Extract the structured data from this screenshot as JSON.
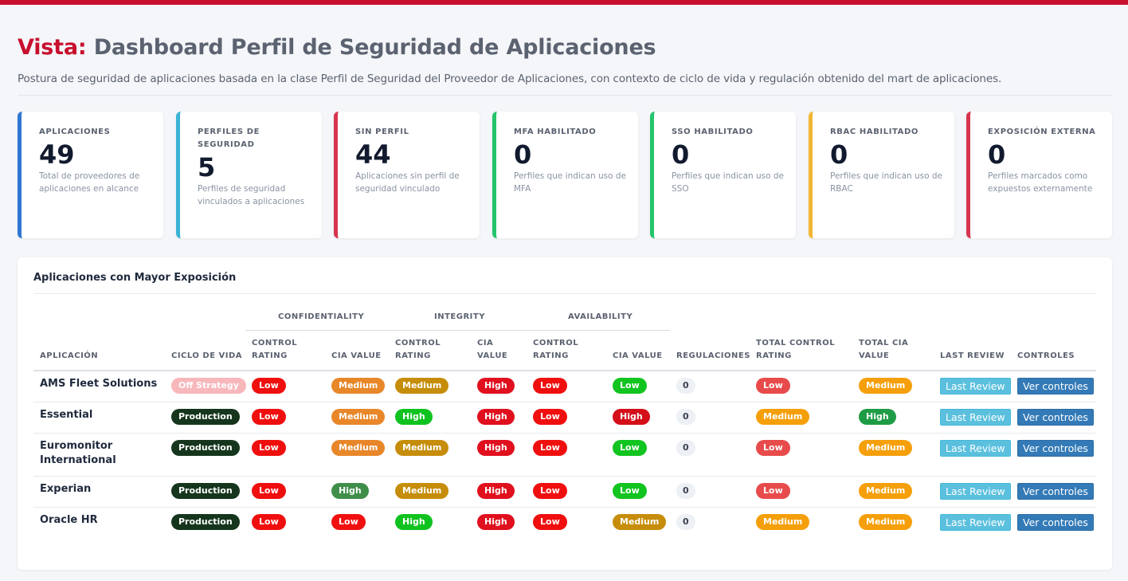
{
  "page": {
    "title_prefix": "Vista:",
    "title": "Dashboard Perfil de Seguridad de Aplicaciones",
    "subtitle": "Postura de seguridad de aplicaciones basada en la clase Perfil de Seguridad del Proveedor de Aplicaciones, con contexto de ciclo de vida y regulación obtenido del mart de aplicaciones."
  },
  "kpis": [
    {
      "label": "APLICACIONES",
      "value": "49",
      "desc": "Total de proveedores de aplicaciones en alcance",
      "color": "#2f76d2"
    },
    {
      "label": "PERFILES DE SEGURIDAD",
      "value": "5",
      "desc": "Perfiles de seguridad vinculados a aplicaciones",
      "color": "#3bb3d6"
    },
    {
      "label": "SIN PERFIL",
      "value": "44",
      "desc": "Aplicaciones sin perfil de seguridad vinculado",
      "color": "#d8344f"
    },
    {
      "label": "MFA HABILITADO",
      "value": "0",
      "desc": "Perfiles que indican uso de MFA",
      "color": "#25c46b"
    },
    {
      "label": "SSO HABILITADO",
      "value": "0",
      "desc": "Perfiles que indican uso de SSO",
      "color": "#25c46b"
    },
    {
      "label": "RBAC HABILITADO",
      "value": "0",
      "desc": "Perfiles que indican uso de RBAC",
      "color": "#f2b632"
    },
    {
      "label": "EXPOSICIÓN EXTERNA",
      "value": "0",
      "desc": "Perfiles marcados como expuestos externamente",
      "color": "#d8344f"
    }
  ],
  "table": {
    "title": "Aplicaciones con Mayor Exposición",
    "groups": {
      "confidentiality": "CONFIDENTIALITY",
      "integrity": "INTEGRITY",
      "availability": "AVAILABILITY"
    },
    "headers": {
      "app": "APLICACIÓN",
      "lifecycle": "CICLO DE VIDA",
      "c_rating": "CONTROL RATING",
      "c_cia": "CIA VALUE",
      "i_rating": "CONTROL RATING",
      "i_cia": "CIA VALUE",
      "a_rating": "CONTROL RATING",
      "a_cia": "CIA VALUE",
      "regs": "REGULACIONES",
      "total_rating": "TOTAL CONTROL RATING",
      "total_cia": "TOTAL CIA VALUE",
      "last_review": "LAST REVIEW",
      "controls": "CONTROLES"
    },
    "rows": [
      {
        "app": "AMS Fleet Solutions",
        "lifecycle": "Off Strategy",
        "c_rating": "Low",
        "c_cia": "Medium",
        "i_rating": "Medium",
        "i_cia": "High",
        "a_rating": "Low",
        "a_cia": "Low",
        "regs": "0",
        "total_rating": "Low",
        "total_cia": "Medium",
        "last_review": "Last Review",
        "controls": "Ver controles"
      },
      {
        "app": "Essential",
        "lifecycle": "Production",
        "c_rating": "Low",
        "c_cia": "Medium",
        "i_rating": "High",
        "i_cia": "High",
        "a_rating": "Low",
        "a_cia": "High",
        "regs": "0",
        "total_rating": "Medium",
        "total_cia": "High",
        "last_review": "Last Review",
        "controls": "Ver controles"
      },
      {
        "app": "Euromonitor International",
        "lifecycle": "Production",
        "c_rating": "Low",
        "c_cia": "Medium",
        "i_rating": "Medium",
        "i_cia": "High",
        "a_rating": "Low",
        "a_cia": "Low",
        "regs": "0",
        "total_rating": "Low",
        "total_cia": "Medium",
        "last_review": "Last Review",
        "controls": "Ver controles"
      },
      {
        "app": "Experian",
        "lifecycle": "Production",
        "c_rating": "Low",
        "c_cia": "High",
        "i_rating": "Medium",
        "i_cia": "High",
        "a_rating": "Low",
        "a_cia": "Low",
        "regs": "0",
        "total_rating": "Low",
        "total_cia": "Medium",
        "last_review": "Last Review",
        "controls": "Ver controles"
      },
      {
        "app": "Oracle HR",
        "lifecycle": "Production",
        "c_rating": "Low",
        "c_cia": "Low",
        "i_rating": "High",
        "i_cia": "High",
        "a_rating": "Low",
        "a_cia": "Medium",
        "regs": "0",
        "total_rating": "Medium",
        "total_cia": "Medium",
        "last_review": "Last Review",
        "controls": "Ver controles"
      }
    ],
    "pill_colors": {
      "lifecycle": {
        "Off Strategy": "#f7b7bb",
        "Production": "#15361d"
      },
      "rating": {
        "Low": "#f00f0f",
        "Medium": "#c68d0a",
        "High": "#10c21f"
      },
      "cia": {
        "Low": "#11c41f",
        "Medium": "#e8872a",
        "High": "#e0101e"
      },
      "cia_alt": {
        "Low": "#f01010",
        "Medium": "#c68d0a",
        "High": "#3f8f4a"
      },
      "total_rating": {
        "Low": "#e84b4b",
        "Medium": "#f59f0a"
      },
      "total_cia": {
        "Medium": "#f59f0a",
        "High": "#1e9c45"
      },
      "regs_bg": "#edf0f4",
      "regs_fg": "#3a4252"
    }
  }
}
